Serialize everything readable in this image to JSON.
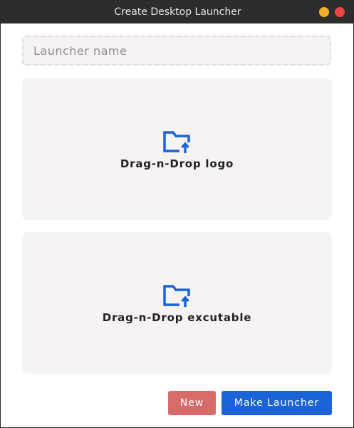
{
  "window": {
    "title": "Create Desktop Launcher"
  },
  "form": {
    "launcher_name_value": "",
    "launcher_name_placeholder": "Launcher name"
  },
  "dropzones": [
    {
      "label": "Drag-n-Drop logo",
      "icon": "folder-upload-icon"
    },
    {
      "label": "Drag-n-Drop excutable",
      "icon": "folder-upload-icon"
    }
  ],
  "buttons": {
    "new_label": "New",
    "make_label": "Make Launcher"
  },
  "colors": {
    "accent": "#1a63d8",
    "danger": "#d86a6a",
    "minimize": "#f3b12a",
    "close": "#ef4444",
    "panel": "#f6f3f2"
  }
}
